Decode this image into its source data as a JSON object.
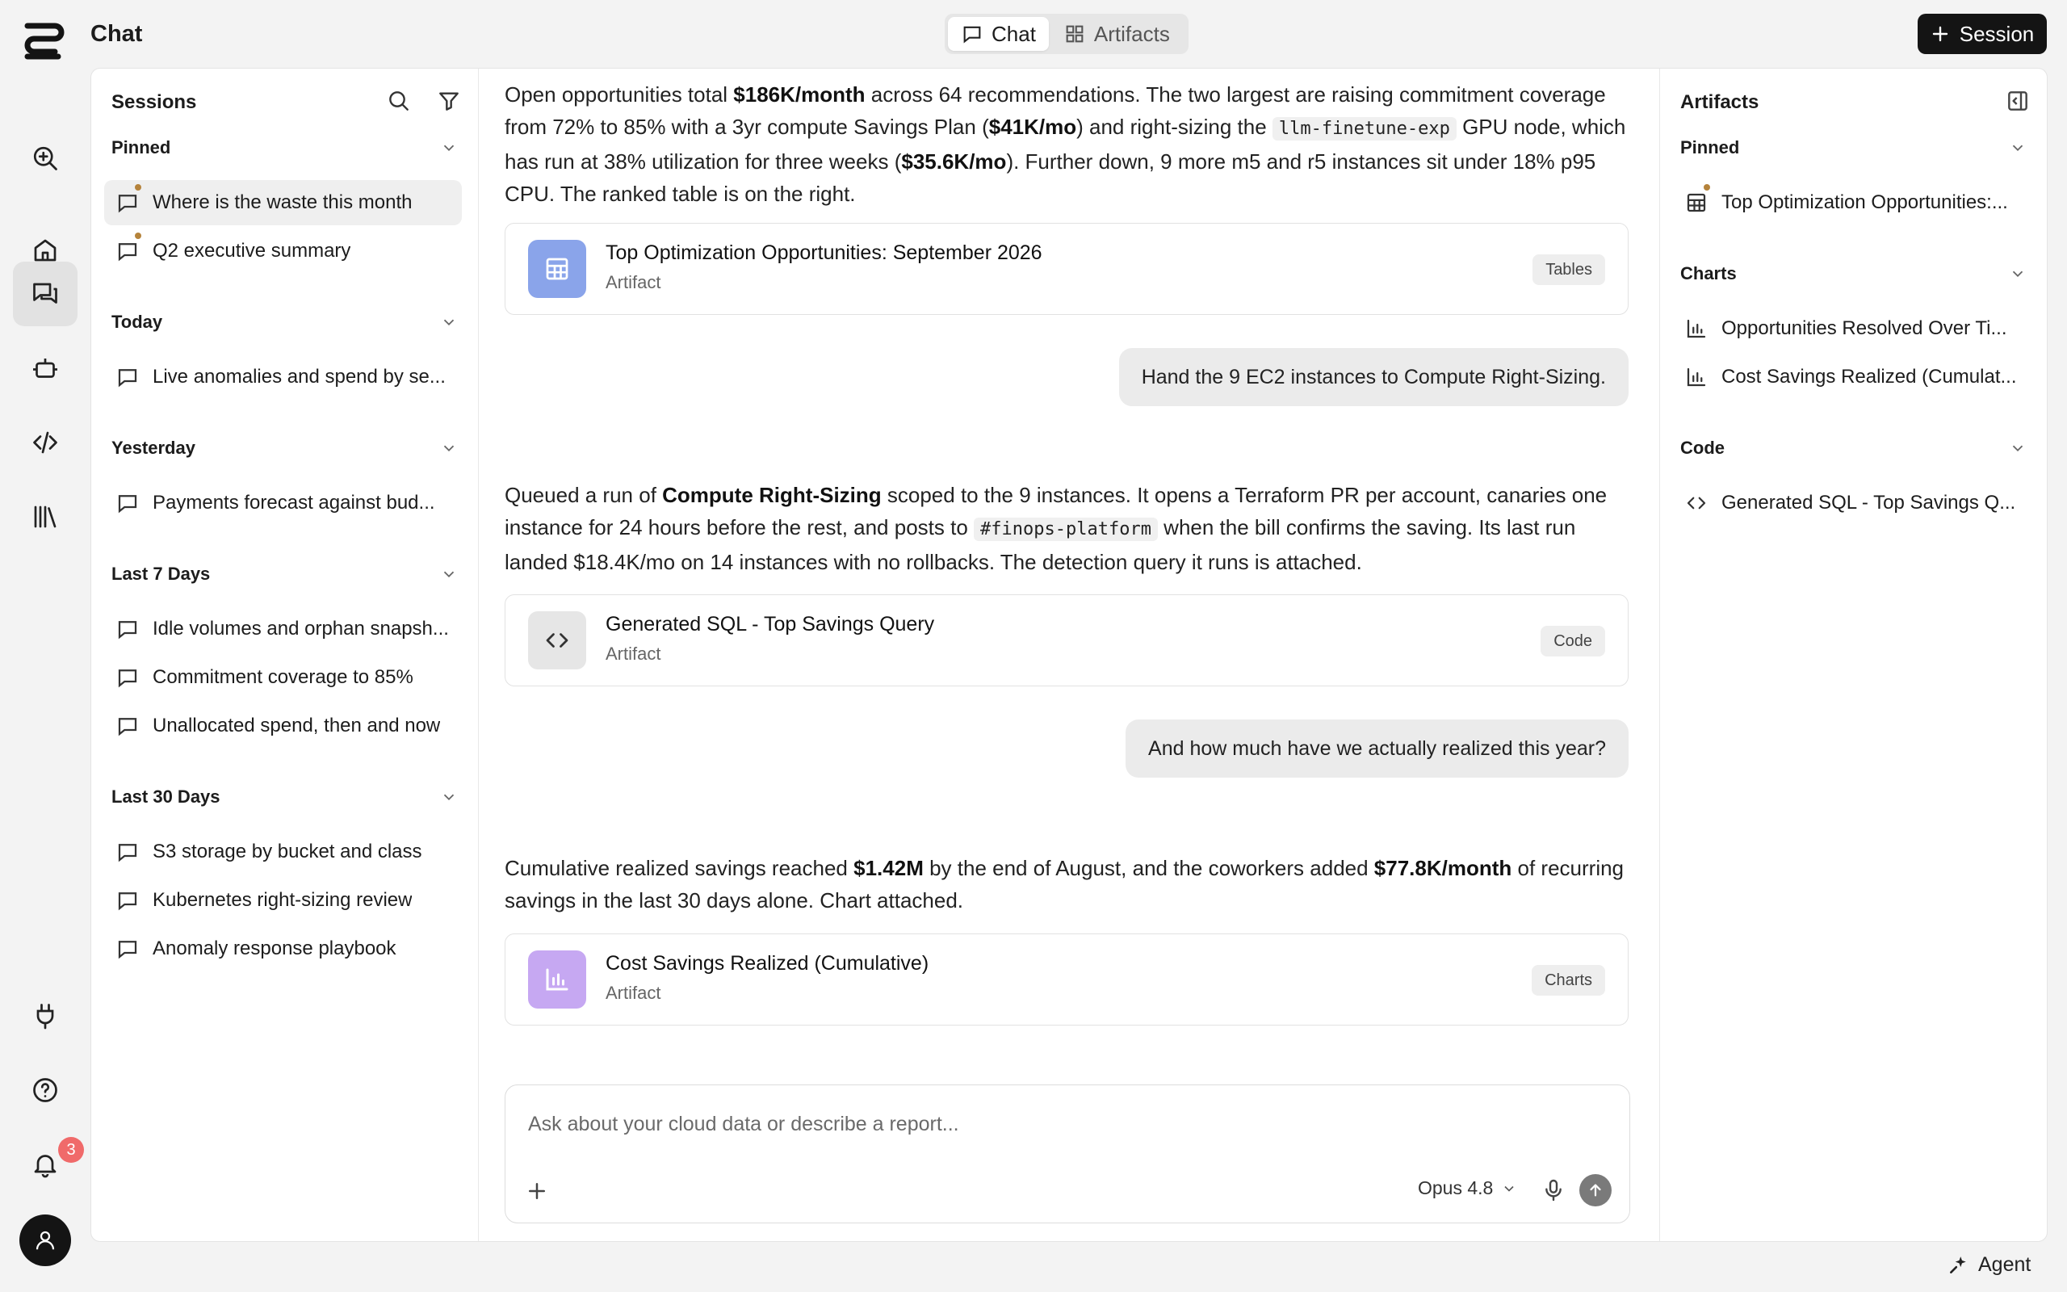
{
  "app": {
    "title": "Chat"
  },
  "header": {
    "tabs": [
      {
        "label": "Chat",
        "icon": "chat-icon",
        "active": true
      },
      {
        "label": "Artifacts",
        "icon": "grid-icon",
        "active": false
      }
    ],
    "new_session_label": "Session"
  },
  "rail": {
    "items": [
      "search-zoom-icon",
      "home-icon",
      "chat-icon",
      "bot-icon",
      "code-icon",
      "library-icon"
    ],
    "bottom": [
      "plug-icon",
      "help-icon",
      "bell-icon"
    ],
    "notification_count": "3"
  },
  "sessions": {
    "title": "Sessions",
    "groups": [
      {
        "label": "Pinned",
        "items": [
          {
            "label": "Where is the waste this month",
            "pinned": true,
            "active": true
          },
          {
            "label": "Q2 executive summary",
            "pinned": true
          }
        ]
      },
      {
        "label": "Today",
        "items": [
          {
            "label": "Live anomalies and spend by se..."
          }
        ]
      },
      {
        "label": "Yesterday",
        "items": [
          {
            "label": "Payments forecast against bud..."
          }
        ]
      },
      {
        "label": "Last 7 Days",
        "items": [
          {
            "label": "Idle volumes and orphan snapsh..."
          },
          {
            "label": "Commitment coverage to 85%"
          },
          {
            "label": "Unallocated spend, then and now"
          }
        ]
      },
      {
        "label": "Last 30 Days",
        "items": [
          {
            "label": "S3 storage by bucket and class"
          },
          {
            "label": "Kubernetes right-sizing review"
          },
          {
            "label": "Anomaly response playbook"
          }
        ]
      }
    ]
  },
  "chat": {
    "messages": [
      {
        "role": "assistant",
        "parts": [
          "Open opportunities total ",
          {
            "b": "$186K/month"
          },
          " across 64 recommendations. The two largest are raising commitment coverage from 72% to 85% with a 3yr compute Savings Plan (",
          {
            "b": "$41K/mo"
          },
          ") and right-sizing the ",
          {
            "code": "llm-finetune-exp"
          },
          " GPU node, which has run at 38% utilization for three weeks (",
          {
            "b": "$35.6K/mo"
          },
          "). Further down, 9 more m5 and r5 instances sit under 18% p95 CPU. The ranked table is on the right."
        ],
        "artifact": {
          "title": "Top Optimization Opportunities: September 2026",
          "subtitle": "Artifact",
          "tag": "Tables",
          "icon": "table-icon",
          "color": "#8aa4ea"
        }
      },
      {
        "role": "user",
        "text": "Hand the 9 EC2 instances to Compute Right-Sizing."
      },
      {
        "role": "assistant",
        "parts": [
          "Queued a run of ",
          {
            "b": "Compute Right-Sizing"
          },
          " scoped to the 9 instances. It opens a Terraform PR per account, canaries one instance for 24 hours before the rest, and posts to ",
          {
            "code": "#finops-platform"
          },
          " when the bill confirms the saving. Its last run landed $18.4K/mo on 14 instances with no rollbacks. The detection query it runs is attached."
        ],
        "artifact": {
          "title": "Generated SQL - Top Savings Query",
          "subtitle": "Artifact",
          "tag": "Code",
          "icon": "code-icon",
          "color": "#e6e6e6"
        }
      },
      {
        "role": "user",
        "text": "And how much have we actually realized this year?"
      },
      {
        "role": "assistant",
        "parts": [
          "Cumulative realized savings reached ",
          {
            "b": "$1.42M"
          },
          " by the end of August, and the coworkers added ",
          {
            "b": "$77.8K/month"
          },
          " of recurring savings in the last 30 days alone. Chart attached."
        ],
        "artifact": {
          "title": "Cost Savings Realized (Cumulative)",
          "subtitle": "Artifact",
          "tag": "Charts",
          "icon": "chart-icon",
          "color": "#c6a8f2"
        }
      }
    ],
    "composer": {
      "placeholder": "Ask about your cloud data or describe a report...",
      "model": "Opus 4.8"
    }
  },
  "artifacts": {
    "title": "Artifacts",
    "groups": [
      {
        "label": "Pinned",
        "items": [
          {
            "label": "Top Optimization Opportunities:...",
            "icon": "table-icon",
            "pinned": true
          }
        ]
      },
      {
        "label": "Charts",
        "items": [
          {
            "label": "Opportunities Resolved Over Ti...",
            "icon": "chart-icon"
          },
          {
            "label": "Cost Savings Realized (Cumulat...",
            "icon": "chart-icon"
          }
        ]
      },
      {
        "label": "Code",
        "items": [
          {
            "label": "Generated SQL - Top Savings Q...",
            "icon": "code-icon"
          }
        ]
      }
    ]
  },
  "footer": {
    "agent_label": "Agent"
  }
}
